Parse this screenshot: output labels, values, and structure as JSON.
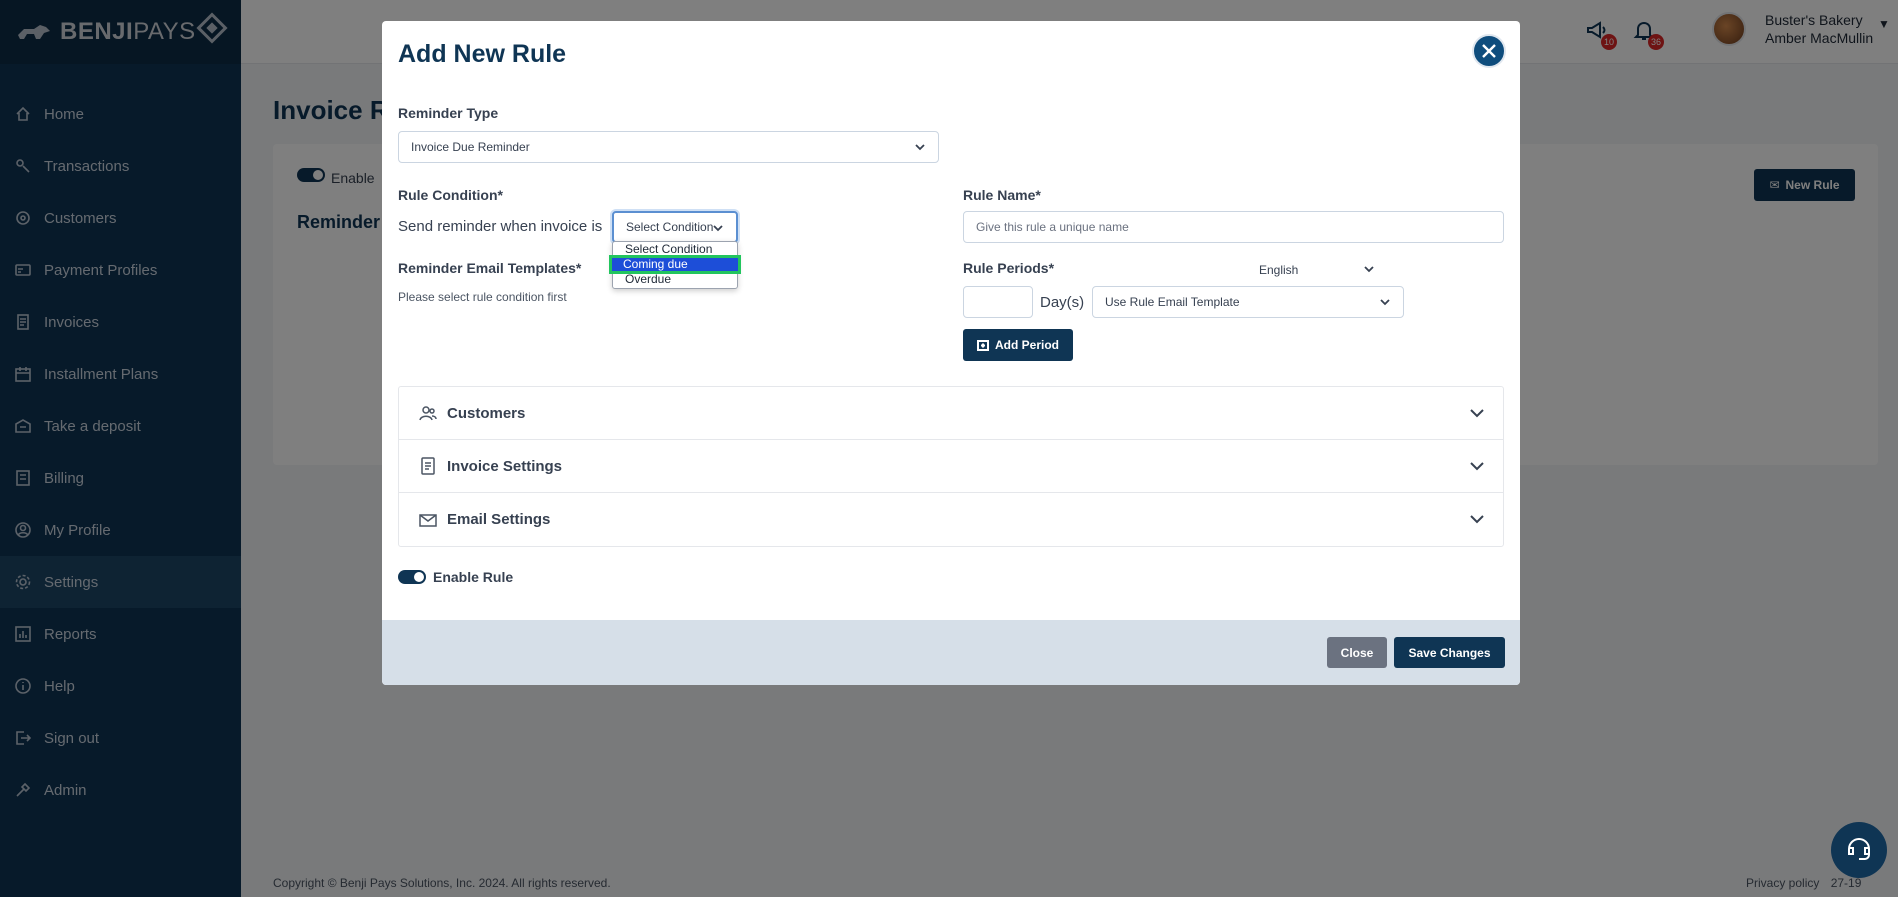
{
  "brand": {
    "name_bold": "BENJI",
    "name_light": "PAYS"
  },
  "sidebar": {
    "items": [
      {
        "label": "Home",
        "icon": "home-icon"
      },
      {
        "label": "Transactions",
        "icon": "transactions-icon"
      },
      {
        "label": "Customers",
        "icon": "customers-icon"
      },
      {
        "label": "Payment Profiles",
        "icon": "payment-profiles-icon"
      },
      {
        "label": "Invoices",
        "icon": "invoices-icon"
      },
      {
        "label": "Installment Plans",
        "icon": "installment-plans-icon"
      },
      {
        "label": "Take a deposit",
        "icon": "deposit-icon"
      },
      {
        "label": "Billing",
        "icon": "billing-icon"
      },
      {
        "label": "My Profile",
        "icon": "profile-icon"
      },
      {
        "label": "Settings",
        "icon": "gear-icon"
      },
      {
        "label": "Reports",
        "icon": "reports-icon"
      },
      {
        "label": "Help",
        "icon": "help-icon"
      },
      {
        "label": "Sign out",
        "icon": "sign-out-icon"
      },
      {
        "label": "Admin",
        "icon": "admin-icon"
      }
    ],
    "active": "Settings"
  },
  "header": {
    "announcements_count": "10",
    "notifications_count": "36",
    "business_name": "Buster's Bakery",
    "user_name": "Amber MacMullin"
  },
  "page": {
    "title": "Invoice Re",
    "enable_label": "Enable",
    "section_title": "Reminder",
    "new_rule_button": "New Rule"
  },
  "modal": {
    "title": "Add New Rule",
    "reminder_type_label": "Reminder Type",
    "reminder_type_value": "Invoice Due Reminder",
    "rule_condition_label": "Rule Condition*",
    "rule_condition_text": "Send reminder when invoice is",
    "condition_select_value": "Select Condition",
    "condition_options": [
      "Select Condition",
      "Coming due",
      "Overdue"
    ],
    "email_templates_label": "Reminder Email Templates*",
    "email_templates_hint": "Please select rule condition first",
    "rule_name_label": "Rule Name*",
    "rule_name_placeholder": "Give this rule a unique name",
    "rule_periods_label": "Rule Periods*",
    "language_value": "English",
    "days_value": "",
    "days_label": "Day(s)",
    "period_template_value": "Use Rule Email Template",
    "add_period_button": "Add Period",
    "accordion": [
      {
        "label": "Customers",
        "icon": "customers-group-icon"
      },
      {
        "label": "Invoice Settings",
        "icon": "document-icon"
      },
      {
        "label": "Email Settings",
        "icon": "envelope-icon"
      }
    ],
    "enable_rule_label": "Enable Rule",
    "close_button": "Close",
    "save_button": "Save Changes"
  },
  "footer": {
    "copyright": "Copyright © Benji Pays Solutions, Inc. 2024. All rights reserved.",
    "privacy": "Privacy policy",
    "version": "27-19"
  },
  "colors": {
    "primary": "#0f3554",
    "highlight_option": "#1d4ed8",
    "highlight_outline": "#22c55e",
    "badge": "#dc2626"
  }
}
